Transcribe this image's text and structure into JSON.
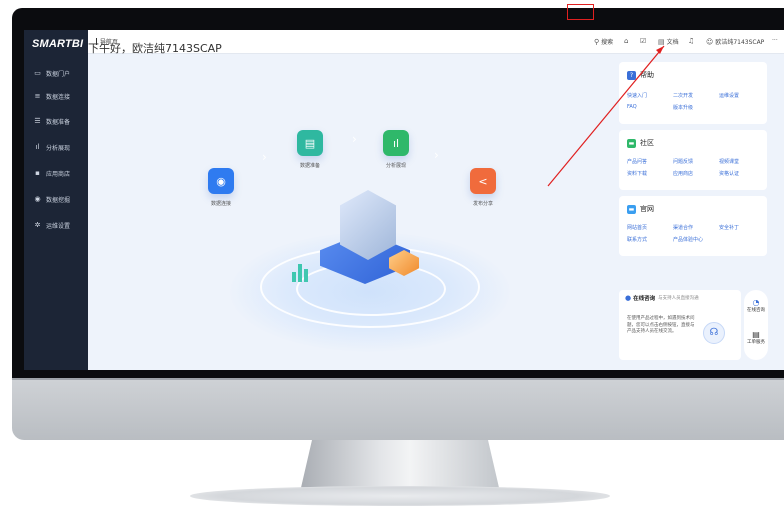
{
  "app": {
    "logo": "SMARTBI",
    "breadcrumb": "导航页",
    "greeting": "下午好，欧洁纯7143SCAP"
  },
  "sidebar": {
    "items": [
      {
        "label": "数据门户",
        "icon": "monitor-icon"
      },
      {
        "label": "数据连接",
        "icon": "database-icon"
      },
      {
        "label": "数据准备",
        "icon": "table-icon"
      },
      {
        "label": "分析展现",
        "icon": "bar-chart-icon"
      },
      {
        "label": "应用商店",
        "icon": "apps-icon"
      },
      {
        "label": "数据挖掘",
        "icon": "mining-icon"
      },
      {
        "label": "运维设置",
        "icon": "gear-icon"
      }
    ]
  },
  "topbar": {
    "search_label": "搜索",
    "document_label": "文档",
    "username": "欧洁纯7143SCAP",
    "more": "···"
  },
  "flow": {
    "steps": [
      {
        "label": "数据连接",
        "color": "#2f7bf0"
      },
      {
        "label": "数据准备",
        "color": "#2fb8a0"
      },
      {
        "label": "分析展现",
        "color": "#2fb86a"
      },
      {
        "label": "发布分享",
        "color": "#f06b3c"
      }
    ]
  },
  "help": {
    "title": "帮助",
    "links": [
      "快速入门",
      "二次开发",
      "运维设置",
      "FAQ",
      "版本升级"
    ]
  },
  "community": {
    "title": "社区",
    "links": [
      "产品问答",
      "问题反馈",
      "视频课堂",
      "资料下载",
      "应用商店",
      "资格认证"
    ]
  },
  "website": {
    "title": "官网",
    "links": [
      "网站首页",
      "渠道合作",
      "安全补丁",
      "联系方式",
      "产品体验中心"
    ]
  },
  "consult": {
    "title": "在线咨询",
    "subtitle": "与支持人员直接沟通",
    "body": "在使用产品过程中，如遇到技术问题，您可以点击右侧按钮，直接与产品支持人员在线交流。"
  },
  "floatbar": {
    "consult_label": "在线咨询",
    "ticket_label": "工单服务"
  },
  "colors": {
    "sidebar_bg": "#1c2536",
    "accent": "#3a6fd8",
    "highlight_box": "#e02020"
  }
}
